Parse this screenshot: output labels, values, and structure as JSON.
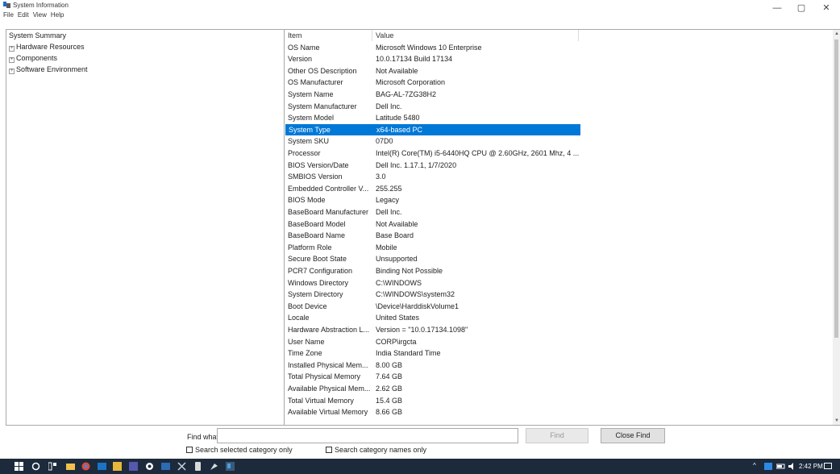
{
  "window": {
    "title": "System Information",
    "controls": {
      "minimize": "—",
      "maximize": "▢",
      "close": "✕"
    }
  },
  "menu": [
    "File",
    "Edit",
    "View",
    "Help"
  ],
  "tree": {
    "items": [
      {
        "label": "System Summary",
        "expandable": false
      },
      {
        "label": "Hardware Resources",
        "expandable": true
      },
      {
        "label": "Components",
        "expandable": true
      },
      {
        "label": "Software Environment",
        "expandable": true
      }
    ]
  },
  "list": {
    "headers": {
      "item": "Item",
      "value": "Value"
    },
    "selected_index": 8,
    "rows": [
      {
        "item": "OS Name",
        "value": "Microsoft Windows 10 Enterprise"
      },
      {
        "item": "Version",
        "value": "10.0.17134 Build 17134"
      },
      {
        "item": "Other OS Description",
        "value": "Not Available"
      },
      {
        "item": "OS Manufacturer",
        "value": "Microsoft Corporation"
      },
      {
        "item": "System Name",
        "value": "BAG-AL-7ZG38H2"
      },
      {
        "item": "System Manufacturer",
        "value": "Dell Inc."
      },
      {
        "item": "System Model",
        "value": "Latitude 5480"
      },
      {
        "item": "System Type",
        "value": "x64-based PC"
      },
      {
        "item": "System SKU",
        "value": "07D0"
      },
      {
        "item": "Processor",
        "value": "Intel(R) Core(TM) i5-6440HQ CPU @ 2.60GHz, 2601 Mhz, 4 ..."
      },
      {
        "item": "BIOS Version/Date",
        "value": "Dell Inc. 1.17.1, 1/7/2020"
      },
      {
        "item": "SMBIOS Version",
        "value": "3.0"
      },
      {
        "item": "Embedded Controller V...",
        "value": "255.255"
      },
      {
        "item": "BIOS Mode",
        "value": "Legacy"
      },
      {
        "item": "BaseBoard Manufacturer",
        "value": "Dell Inc."
      },
      {
        "item": "BaseBoard Model",
        "value": "Not Available"
      },
      {
        "item": "BaseBoard Name",
        "value": "Base Board"
      },
      {
        "item": "Platform Role",
        "value": "Mobile"
      },
      {
        "item": "Secure Boot State",
        "value": "Unsupported"
      },
      {
        "item": "PCR7 Configuration",
        "value": "Binding Not Possible"
      },
      {
        "item": "Windows Directory",
        "value": "C:\\WINDOWS"
      },
      {
        "item": "System Directory",
        "value": "C:\\WINDOWS\\system32"
      },
      {
        "item": "Boot Device",
        "value": "\\Device\\HarddiskVolume1"
      },
      {
        "item": "Locale",
        "value": "United States"
      },
      {
        "item": "Hardware Abstraction L...",
        "value": "Version = \"10.0.17134.1098\""
      },
      {
        "item": "User Name",
        "value": "CORP\\irgcta"
      },
      {
        "item": "Time Zone",
        "value": "India Standard Time"
      },
      {
        "item": "Installed Physical Mem...",
        "value": "8.00 GB"
      },
      {
        "item": "Total Physical Memory",
        "value": "7.64 GB"
      },
      {
        "item": "Available Physical Mem...",
        "value": "2.62 GB"
      },
      {
        "item": "Total Virtual Memory",
        "value": "15.4 GB"
      },
      {
        "item": "Available Virtual Memory",
        "value": "8.66 GB"
      }
    ]
  },
  "find": {
    "label": "Find what:",
    "input_value": "",
    "find_button": "Find",
    "close_find_button": "Close Find",
    "search_selected_label": "Search selected category only",
    "search_names_label": "Search category names only",
    "search_selected_checked": false,
    "search_names_checked": false
  },
  "taskbar": {
    "clock": "2:42 PM",
    "icons": [
      "windows-start",
      "search",
      "task-view",
      "file-explorer",
      "chrome",
      "outlook",
      "sticky-notes",
      "teams",
      "settings",
      "powershell",
      "snipping-tool",
      "phone",
      "paint",
      "system-information"
    ]
  },
  "colors": {
    "selection": "#0078d7",
    "taskbar": "#1c2a3c"
  }
}
